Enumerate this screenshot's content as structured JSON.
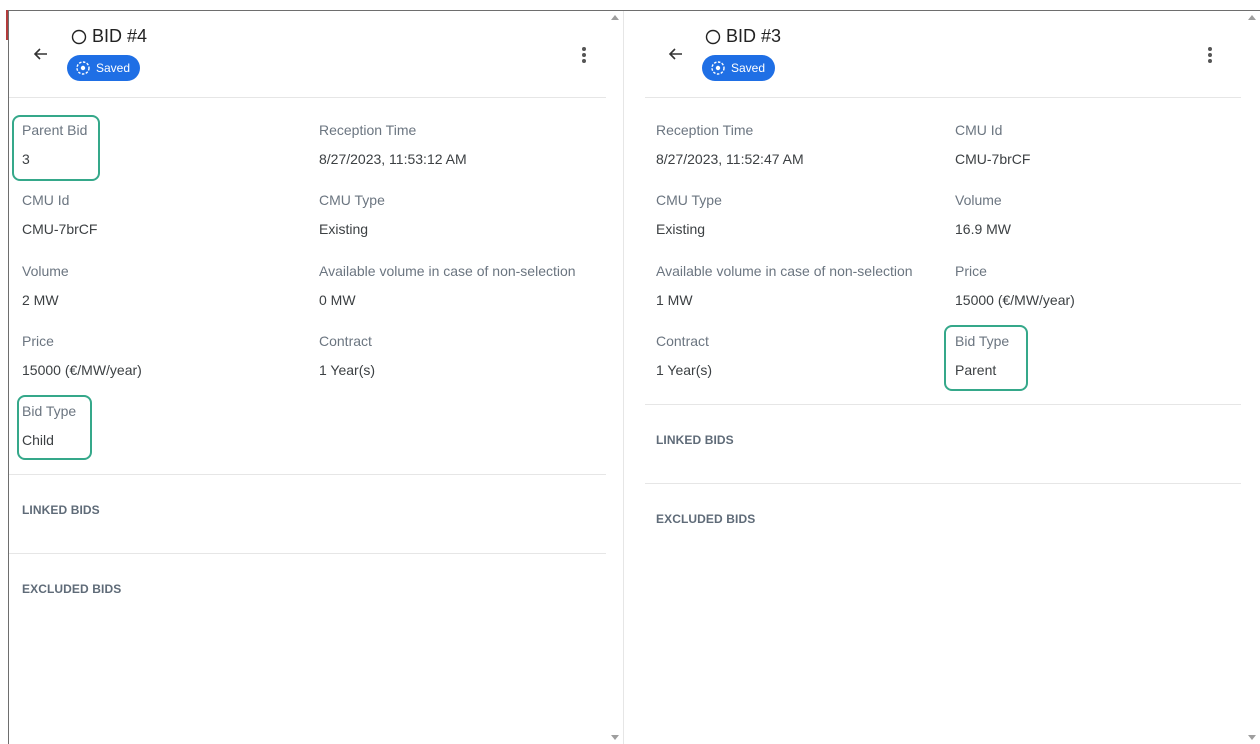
{
  "left_panel": {
    "title": "BID #4",
    "status": "Saved",
    "fields": [
      {
        "label": "Parent Bid",
        "value": "3"
      },
      {
        "label": "Reception Time",
        "value": "8/27/2023, 11:53:12 AM"
      },
      {
        "label": "CMU Id",
        "value": "CMU-7brCF"
      },
      {
        "label": "CMU Type",
        "value": "Existing"
      },
      {
        "label": "Volume",
        "value": "2 MW"
      },
      {
        "label": "Available volume in case of non-selection",
        "value": "0 MW"
      },
      {
        "label": "Price",
        "value": "15000 (€/MW/year)"
      },
      {
        "label": "Contract",
        "value": "1 Year(s)"
      },
      {
        "label": "Bid Type",
        "value": "Child"
      }
    ],
    "sections": {
      "linked": "LINKED BIDS",
      "excluded": "EXCLUDED BIDS"
    }
  },
  "right_panel": {
    "title": "BID #3",
    "status": "Saved",
    "fields": [
      {
        "label": "Reception Time",
        "value": "8/27/2023, 11:52:47 AM"
      },
      {
        "label": "CMU Id",
        "value": "CMU-7brCF"
      },
      {
        "label": "CMU Type",
        "value": "Existing"
      },
      {
        "label": "Volume",
        "value": "16.9 MW"
      },
      {
        "label": "Available volume in case of non-selection",
        "value": "1 MW"
      },
      {
        "label": "Price",
        "value": "15000 (€/MW/year)"
      },
      {
        "label": "Contract",
        "value": "1 Year(s)"
      },
      {
        "label": "Bid Type",
        "value": "Parent"
      }
    ],
    "sections": {
      "linked": "LINKED BIDS",
      "excluded": "EXCLUDED BIDS"
    }
  },
  "icons": {
    "back": "arrow-left-icon",
    "status": "radio-circle-icon",
    "saved": "target-icon",
    "menu": "kebab-menu-icon"
  },
  "colors": {
    "accent": "#1f6fe5",
    "highlight": "#35a88a"
  }
}
